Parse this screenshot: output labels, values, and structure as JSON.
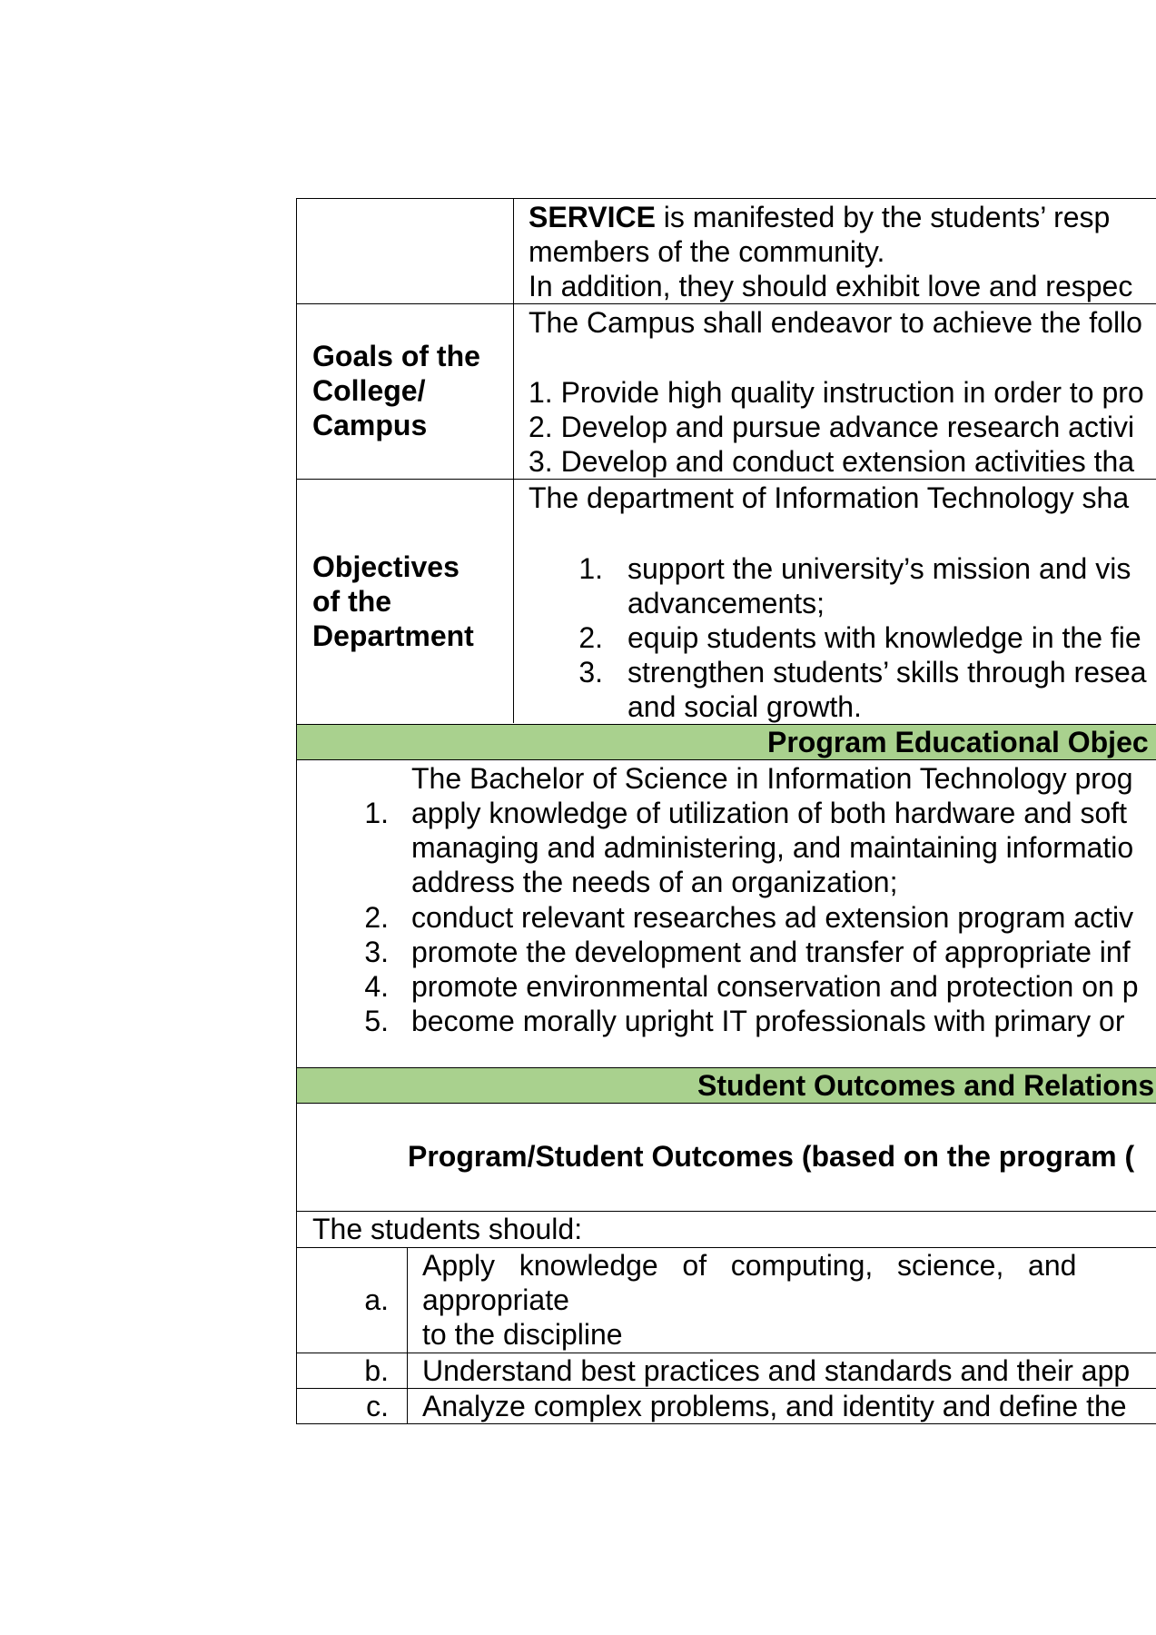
{
  "service": {
    "bold": "SERVICE",
    "line1_rest": " is manifested by the students’ resp",
    "line2": "members of the community.",
    "line3": "In addition, they should exhibit love and respec"
  },
  "goals": {
    "label": [
      "Goals of the",
      "College/",
      "Campus"
    ],
    "intro": "The Campus shall endeavor to achieve the follo",
    "items": [
      "1. Provide high quality instruction in order to pro",
      "2. Develop and pursue advance research activi",
      "3. Develop and conduct extension activities tha"
    ]
  },
  "objectives": {
    "label": [
      "Objectives",
      "of the",
      "Department"
    ],
    "intro": "The department of Information Technology sha",
    "items": [
      {
        "num": "1.",
        "lines": [
          "support the university’s mission and vis",
          "advancements;"
        ]
      },
      {
        "num": "2.",
        "lines": [
          "equip students with knowledge in the fie"
        ]
      },
      {
        "num": "3.",
        "lines": [
          "strengthen students’ skills through resea",
          "and social growth."
        ]
      }
    ]
  },
  "peo": {
    "heading": "Program Educational Objec",
    "intro": "The Bachelor of Science in Information Technology prog",
    "items": [
      {
        "num": "1.",
        "lines": [
          "apply knowledge of utilization of both hardware and soft",
          "managing and administering, and maintaining informatio",
          "address the needs of an organization;"
        ]
      },
      {
        "num": "2.",
        "lines": [
          "conduct relevant researches ad extension program activ"
        ]
      },
      {
        "num": "3.",
        "lines": [
          "promote the development and transfer of appropriate inf"
        ]
      },
      {
        "num": "4.",
        "lines": [
          "promote environmental conservation and protection on p"
        ]
      },
      {
        "num": "5.",
        "lines": [
          "become morally upright IT professionals with primary or"
        ]
      }
    ]
  },
  "outcomes": {
    "heading": "Student Outcomes and Relations",
    "subheading": "Program/Student Outcomes (based on the program (",
    "lead": "The students should:",
    "rows": [
      {
        "letter": "a.",
        "lines": [
          "Apply   knowledge   of   computing,   science,   and",
          "appropriate",
          "to the discipline"
        ]
      },
      {
        "letter": "b.",
        "lines": [
          "Understand best practices and standards and their app"
        ]
      },
      {
        "letter": "c.",
        "lines": [
          "Analyze complex problems, and identity and define the"
        ]
      }
    ]
  }
}
